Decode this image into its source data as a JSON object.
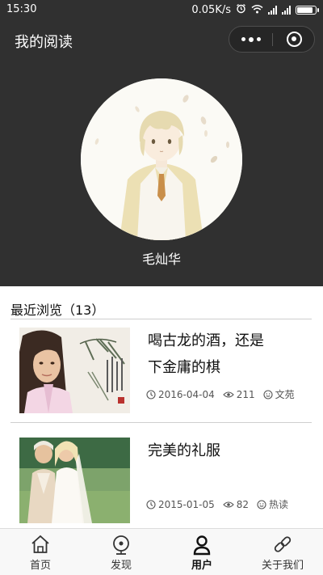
{
  "status_bar": {
    "time": "15:30",
    "network_speed": "0.05K/s",
    "icons": [
      "alarm-icon",
      "wifi-icon",
      "signal-icon",
      "signal-icon",
      "battery-icon"
    ],
    "battery_level": 0.9
  },
  "nav": {
    "title": "我的阅读",
    "menu_icon": "more-dots-icon",
    "close_icon": "target-ring-icon"
  },
  "profile": {
    "username": "毛灿华"
  },
  "recent": {
    "title": "最近浏览（13）",
    "items": [
      {
        "title_line1": "喝古龙的酒，还是",
        "title_line2": "下金庸的棋",
        "date": "2016-04-04",
        "views": "211",
        "source": "文苑"
      },
      {
        "title_line1": "完美的礼服",
        "title_line2": "",
        "date": "2015-01-05",
        "views": "82",
        "source": "热读"
      }
    ]
  },
  "tabbar": {
    "tabs": [
      {
        "label": "首页",
        "icon": "home-icon"
      },
      {
        "label": "发现",
        "icon": "discover-icon"
      },
      {
        "label": "用户",
        "icon": "user-icon"
      },
      {
        "label": "关于我们",
        "icon": "link-icon"
      }
    ],
    "active_index": 2
  },
  "colors": {
    "header_bg": "#303030",
    "page_bg": "#ffffff",
    "tabbar_bg": "#f8f8f8"
  }
}
